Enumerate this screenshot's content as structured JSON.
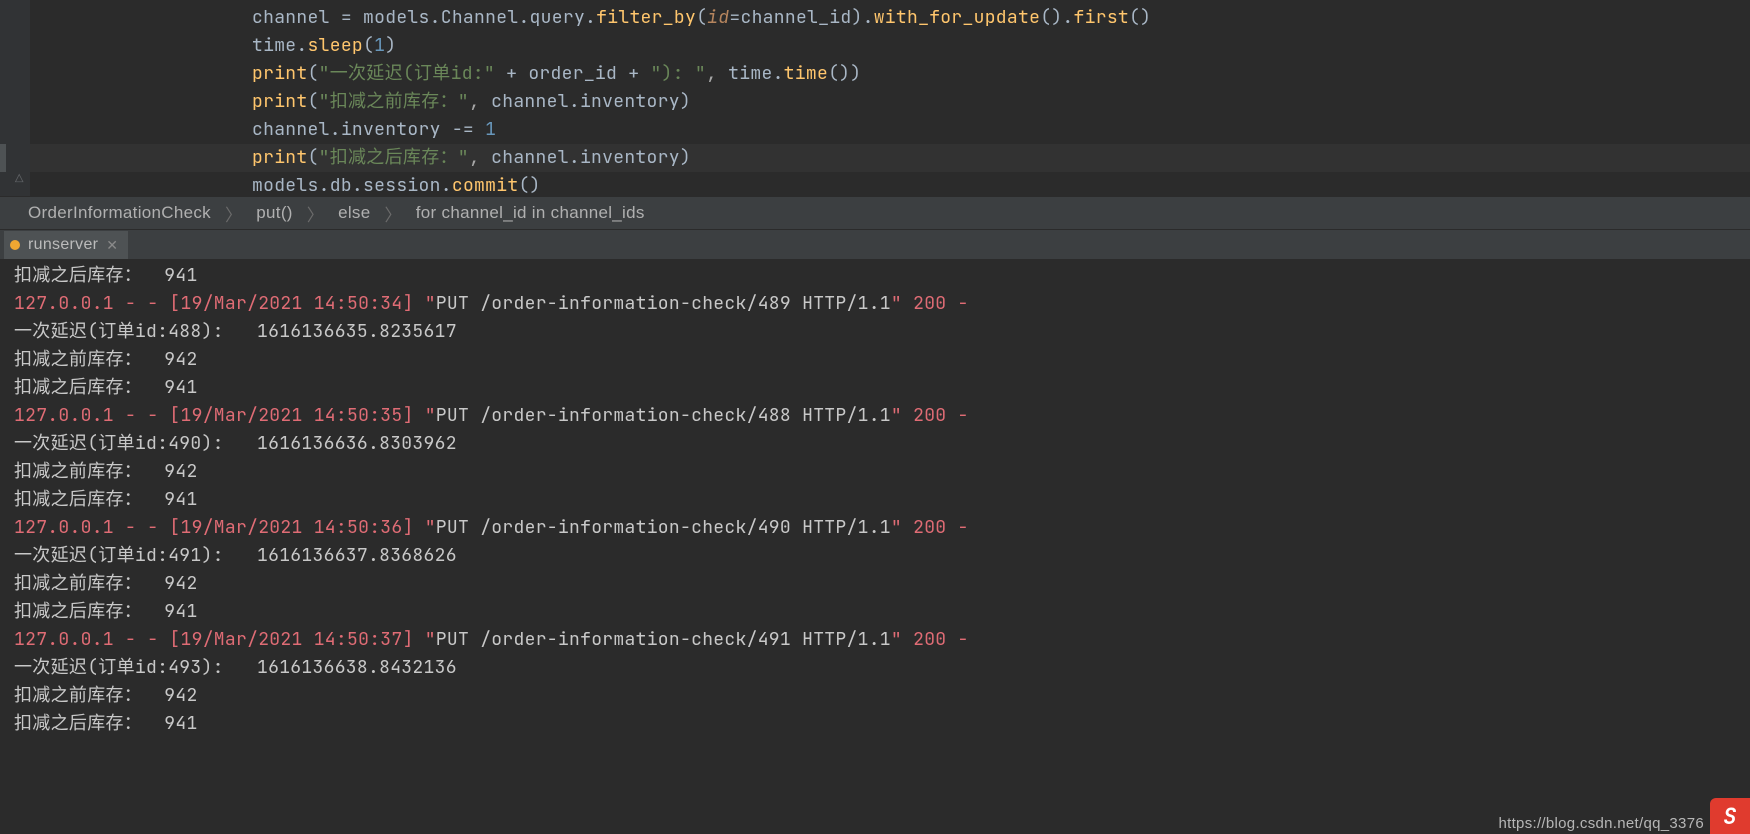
{
  "editor": {
    "indent": "                    ",
    "lines": [
      {
        "hl": false,
        "segments": [
          {
            "t": "channel ",
            "c": "id"
          },
          {
            "t": "= ",
            "c": "id"
          },
          {
            "t": "models",
            "c": "id"
          },
          {
            "t": ".",
            "c": "id"
          },
          {
            "t": "Channel",
            "c": "id"
          },
          {
            "t": ".",
            "c": "id"
          },
          {
            "t": "query",
            "c": "id"
          },
          {
            "t": ".",
            "c": "id"
          },
          {
            "t": "filter_by",
            "c": "fn"
          },
          {
            "t": "(",
            "c": "id"
          },
          {
            "t": "id",
            "c": "prm"
          },
          {
            "t": "=channel_id",
            "c": "id"
          },
          {
            "t": ")",
            "c": "id"
          },
          {
            "t": ".",
            "c": "id"
          },
          {
            "t": "with_for_update",
            "c": "fn"
          },
          {
            "t": "()",
            "c": "id"
          },
          {
            "t": ".",
            "c": "id"
          },
          {
            "t": "first",
            "c": "fn"
          },
          {
            "t": "()",
            "c": "id"
          }
        ]
      },
      {
        "hl": false,
        "segments": [
          {
            "t": "time",
            "c": "id"
          },
          {
            "t": ".",
            "c": "id"
          },
          {
            "t": "sleep",
            "c": "fn"
          },
          {
            "t": "(",
            "c": "id"
          },
          {
            "t": "1",
            "c": "num"
          },
          {
            "t": ")",
            "c": "id"
          }
        ]
      },
      {
        "hl": false,
        "segments": [
          {
            "t": "print",
            "c": "fn"
          },
          {
            "t": "(",
            "c": "id"
          },
          {
            "t": "\"一次延迟(订单id:\"",
            "c": "str"
          },
          {
            "t": " + ",
            "c": "id"
          },
          {
            "t": "order_id",
            "c": "id"
          },
          {
            "t": " + ",
            "c": "id"
          },
          {
            "t": "\"): \"",
            "c": "str"
          },
          {
            "t": ", ",
            "c": "par"
          },
          {
            "t": "time",
            "c": "id"
          },
          {
            "t": ".",
            "c": "id"
          },
          {
            "t": "time",
            "c": "fn"
          },
          {
            "t": "())",
            "c": "id"
          }
        ]
      },
      {
        "hl": false,
        "segments": [
          {
            "t": "print",
            "c": "fn"
          },
          {
            "t": "(",
            "c": "id"
          },
          {
            "t": "\"扣减之前库存：\"",
            "c": "str"
          },
          {
            "t": ", ",
            "c": "par"
          },
          {
            "t": "channel",
            "c": "id"
          },
          {
            "t": ".",
            "c": "id"
          },
          {
            "t": "inventory",
            "c": "id"
          },
          {
            "t": ")",
            "c": "id"
          }
        ]
      },
      {
        "hl": false,
        "segments": [
          {
            "t": "channel",
            "c": "id"
          },
          {
            "t": ".",
            "c": "id"
          },
          {
            "t": "inventory ",
            "c": "id"
          },
          {
            "t": "-= ",
            "c": "id"
          },
          {
            "t": "1",
            "c": "num"
          }
        ]
      },
      {
        "hl": true,
        "segments": [
          {
            "t": "print",
            "c": "fn"
          },
          {
            "t": "(",
            "c": "id"
          },
          {
            "t": "\"扣减之后库存：\"",
            "c": "str"
          },
          {
            "t": ", ",
            "c": "par"
          },
          {
            "t": "channel",
            "c": "id"
          },
          {
            "t": ".",
            "c": "id"
          },
          {
            "t": "inventory",
            "c": "id"
          },
          {
            "t": ")",
            "c": "id"
          }
        ]
      },
      {
        "hl": false,
        "segments": [
          {
            "t": "models",
            "c": "id"
          },
          {
            "t": ".",
            "c": "id"
          },
          {
            "t": "db",
            "c": "id"
          },
          {
            "t": ".",
            "c": "id"
          },
          {
            "t": "session",
            "c": "id"
          },
          {
            "t": ".",
            "c": "id"
          },
          {
            "t": "commit",
            "c": "fn"
          },
          {
            "t": "()",
            "c": "id"
          }
        ]
      }
    ]
  },
  "breadcrumbs": {
    "sep": "〉",
    "items": [
      "OrderInformationCheck",
      "put()",
      "else",
      "for channel_id in channel_ids"
    ]
  },
  "toolTab": {
    "label": "runserver",
    "close": "✕"
  },
  "console": {
    "lines": [
      {
        "segments": [
          {
            "t": "扣减之后库存：  941",
            "c": "grey"
          }
        ]
      },
      {
        "segments": [
          {
            "t": "127.0.0.1 - - [19/Mar/2021 14:50:34] \"",
            "c": "http"
          },
          {
            "t": "PUT /order-information-check/489 HTTP/1.1",
            "c": "grey"
          },
          {
            "t": "\" 200 -",
            "c": "http"
          }
        ]
      },
      {
        "segments": [
          {
            "t": "一次延迟(订单id:488):   1616136635.8235617",
            "c": "grey"
          }
        ]
      },
      {
        "segments": [
          {
            "t": "扣减之前库存：  942",
            "c": "grey"
          }
        ]
      },
      {
        "segments": [
          {
            "t": "扣减之后库存：  941",
            "c": "grey"
          }
        ]
      },
      {
        "segments": [
          {
            "t": "127.0.0.1 - - [19/Mar/2021 14:50:35] \"",
            "c": "http"
          },
          {
            "t": "PUT /order-information-check/488 HTTP/1.1",
            "c": "grey"
          },
          {
            "t": "\" 200 -",
            "c": "http"
          }
        ]
      },
      {
        "segments": [
          {
            "t": "一次延迟(订单id:490):   1616136636.8303962",
            "c": "grey"
          }
        ]
      },
      {
        "segments": [
          {
            "t": "扣减之前库存：  942",
            "c": "grey"
          }
        ]
      },
      {
        "segments": [
          {
            "t": "扣减之后库存：  941",
            "c": "grey"
          }
        ]
      },
      {
        "segments": [
          {
            "t": "127.0.0.1 - - [19/Mar/2021 14:50:36] \"",
            "c": "http"
          },
          {
            "t": "PUT /order-information-check/490 HTTP/1.1",
            "c": "grey"
          },
          {
            "t": "\" 200 -",
            "c": "http"
          }
        ]
      },
      {
        "segments": [
          {
            "t": "一次延迟(订单id:491):   1616136637.8368626",
            "c": "grey"
          }
        ]
      },
      {
        "segments": [
          {
            "t": "扣减之前库存：  942",
            "c": "grey"
          }
        ]
      },
      {
        "segments": [
          {
            "t": "扣减之后库存：  941",
            "c": "grey"
          }
        ]
      },
      {
        "segments": [
          {
            "t": "127.0.0.1 - - [19/Mar/2021 14:50:37] \"",
            "c": "http"
          },
          {
            "t": "PUT /order-information-check/491 HTTP/1.1",
            "c": "grey"
          },
          {
            "t": "\" 200 -",
            "c": "http"
          }
        ]
      },
      {
        "segments": [
          {
            "t": "一次延迟(订单id:493):   1616136638.8432136",
            "c": "grey"
          }
        ]
      },
      {
        "segments": [
          {
            "t": "扣减之前库存：  942",
            "c": "grey"
          }
        ]
      },
      {
        "segments": [
          {
            "t": "扣减之后库存：  941",
            "c": "grey"
          }
        ]
      }
    ]
  },
  "watermark": {
    "text": "https://blog.csdn.net/qq_3376",
    "badge": "S"
  }
}
